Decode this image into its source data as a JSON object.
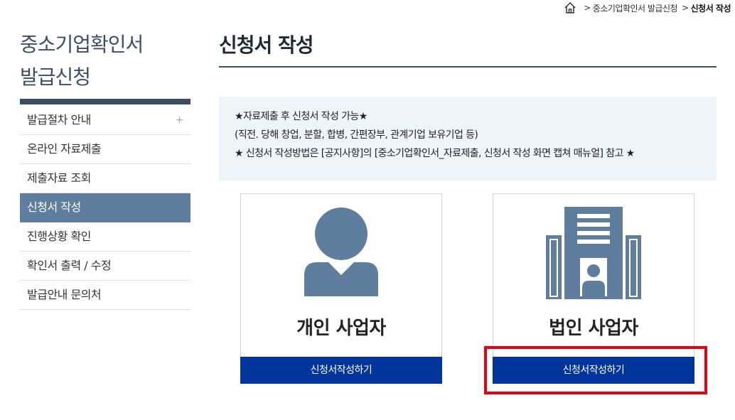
{
  "breadcrumb": {
    "home_icon": "home-icon",
    "items": [
      "중소기업확인서 발급신청",
      "신청서 작성"
    ]
  },
  "sidebar": {
    "title_line1": "중소기업확인서",
    "title_line2": "발급신청",
    "items": [
      {
        "label": "발급절차 안내",
        "expand": "+"
      },
      {
        "label": "온라인 자료제출"
      },
      {
        "label": "제출자료 조회"
      },
      {
        "label": "신청서 작성"
      },
      {
        "label": "진행상황 확인"
      },
      {
        "label": "확인서 출력 / 수정"
      },
      {
        "label": "발급안내 문의처"
      }
    ]
  },
  "main": {
    "title": "신청서 작성",
    "notice": [
      "★자료제출 후 신청서 작성 가능★",
      "(직전. 당해 창업, 분할, 합병, 간편장부, 관계기업 보유기업 등)",
      "★ 신청서 작성방법은 [공지사항]의 [중소기업확인서_자료제출, 신청서 작성 화면 캡쳐 매뉴얼] 참고 ★"
    ],
    "cards": [
      {
        "label": "개인 사업자",
        "button": "신청서작성하기",
        "icon": "person-icon"
      },
      {
        "label": "법인 사업자",
        "button": "신청서작성하기",
        "icon": "building-icon"
      }
    ]
  },
  "colors": {
    "primary_button": "#00359b",
    "sidebar_active": "#5f7d9d",
    "icon": "#5f7d9d",
    "highlight": "#e60012"
  }
}
